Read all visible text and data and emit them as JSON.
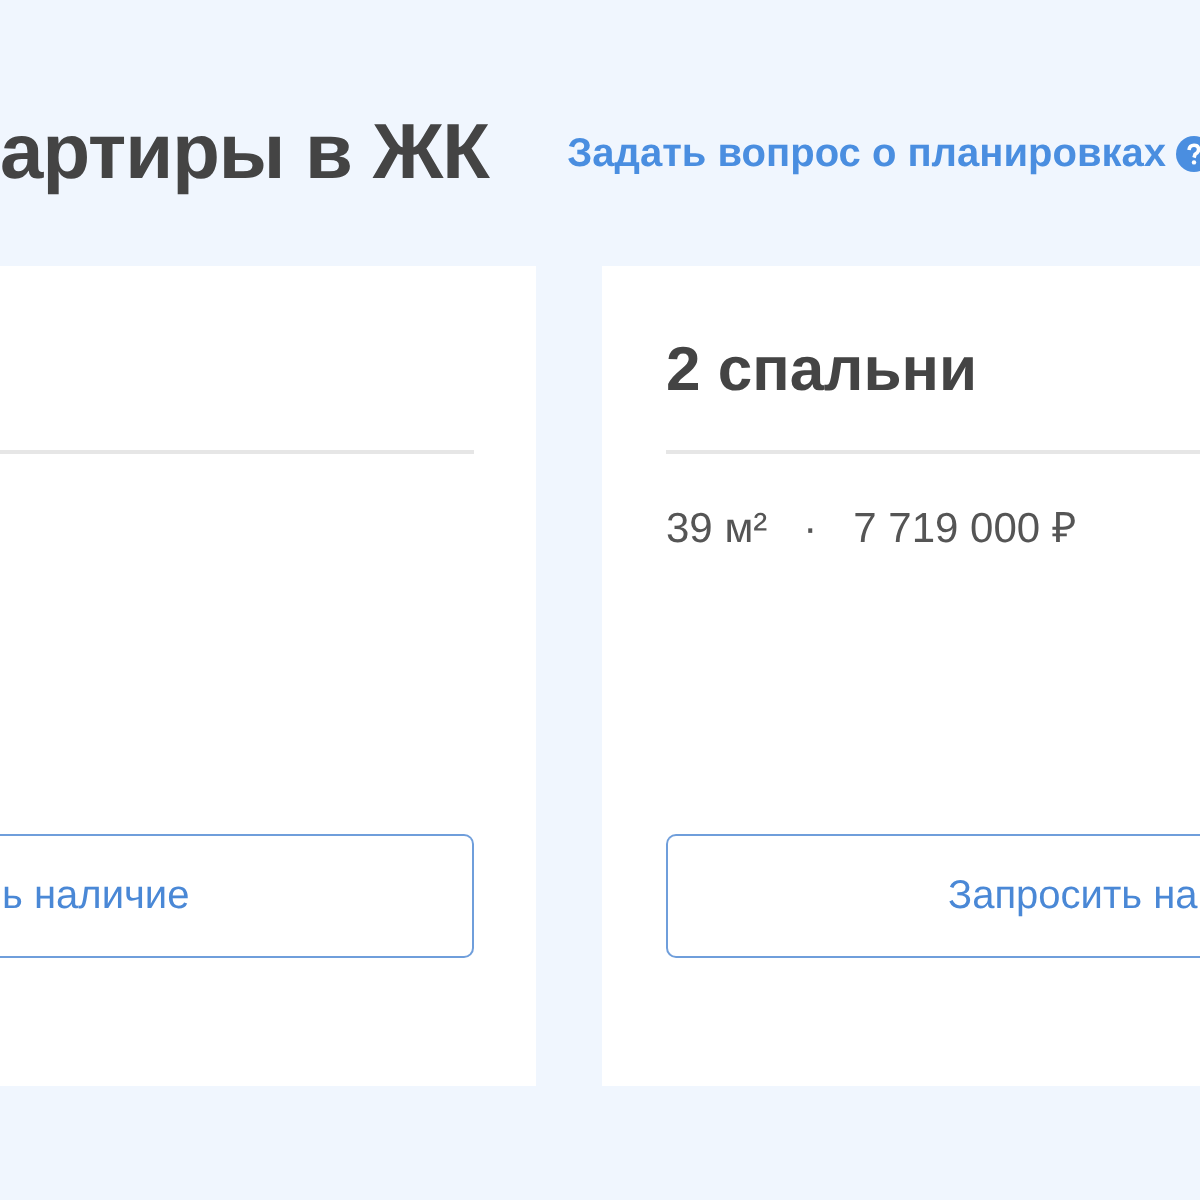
{
  "header": {
    "title": "артиры в ЖК",
    "help_link": "Задать вопрос о планировках"
  },
  "cards": [
    {
      "button": "ь наличие"
    },
    {
      "heading": "2 спальни",
      "area": "39 м²",
      "separator": "·",
      "price": "7 719 000 ₽",
      "button": "Запросить на"
    }
  ]
}
